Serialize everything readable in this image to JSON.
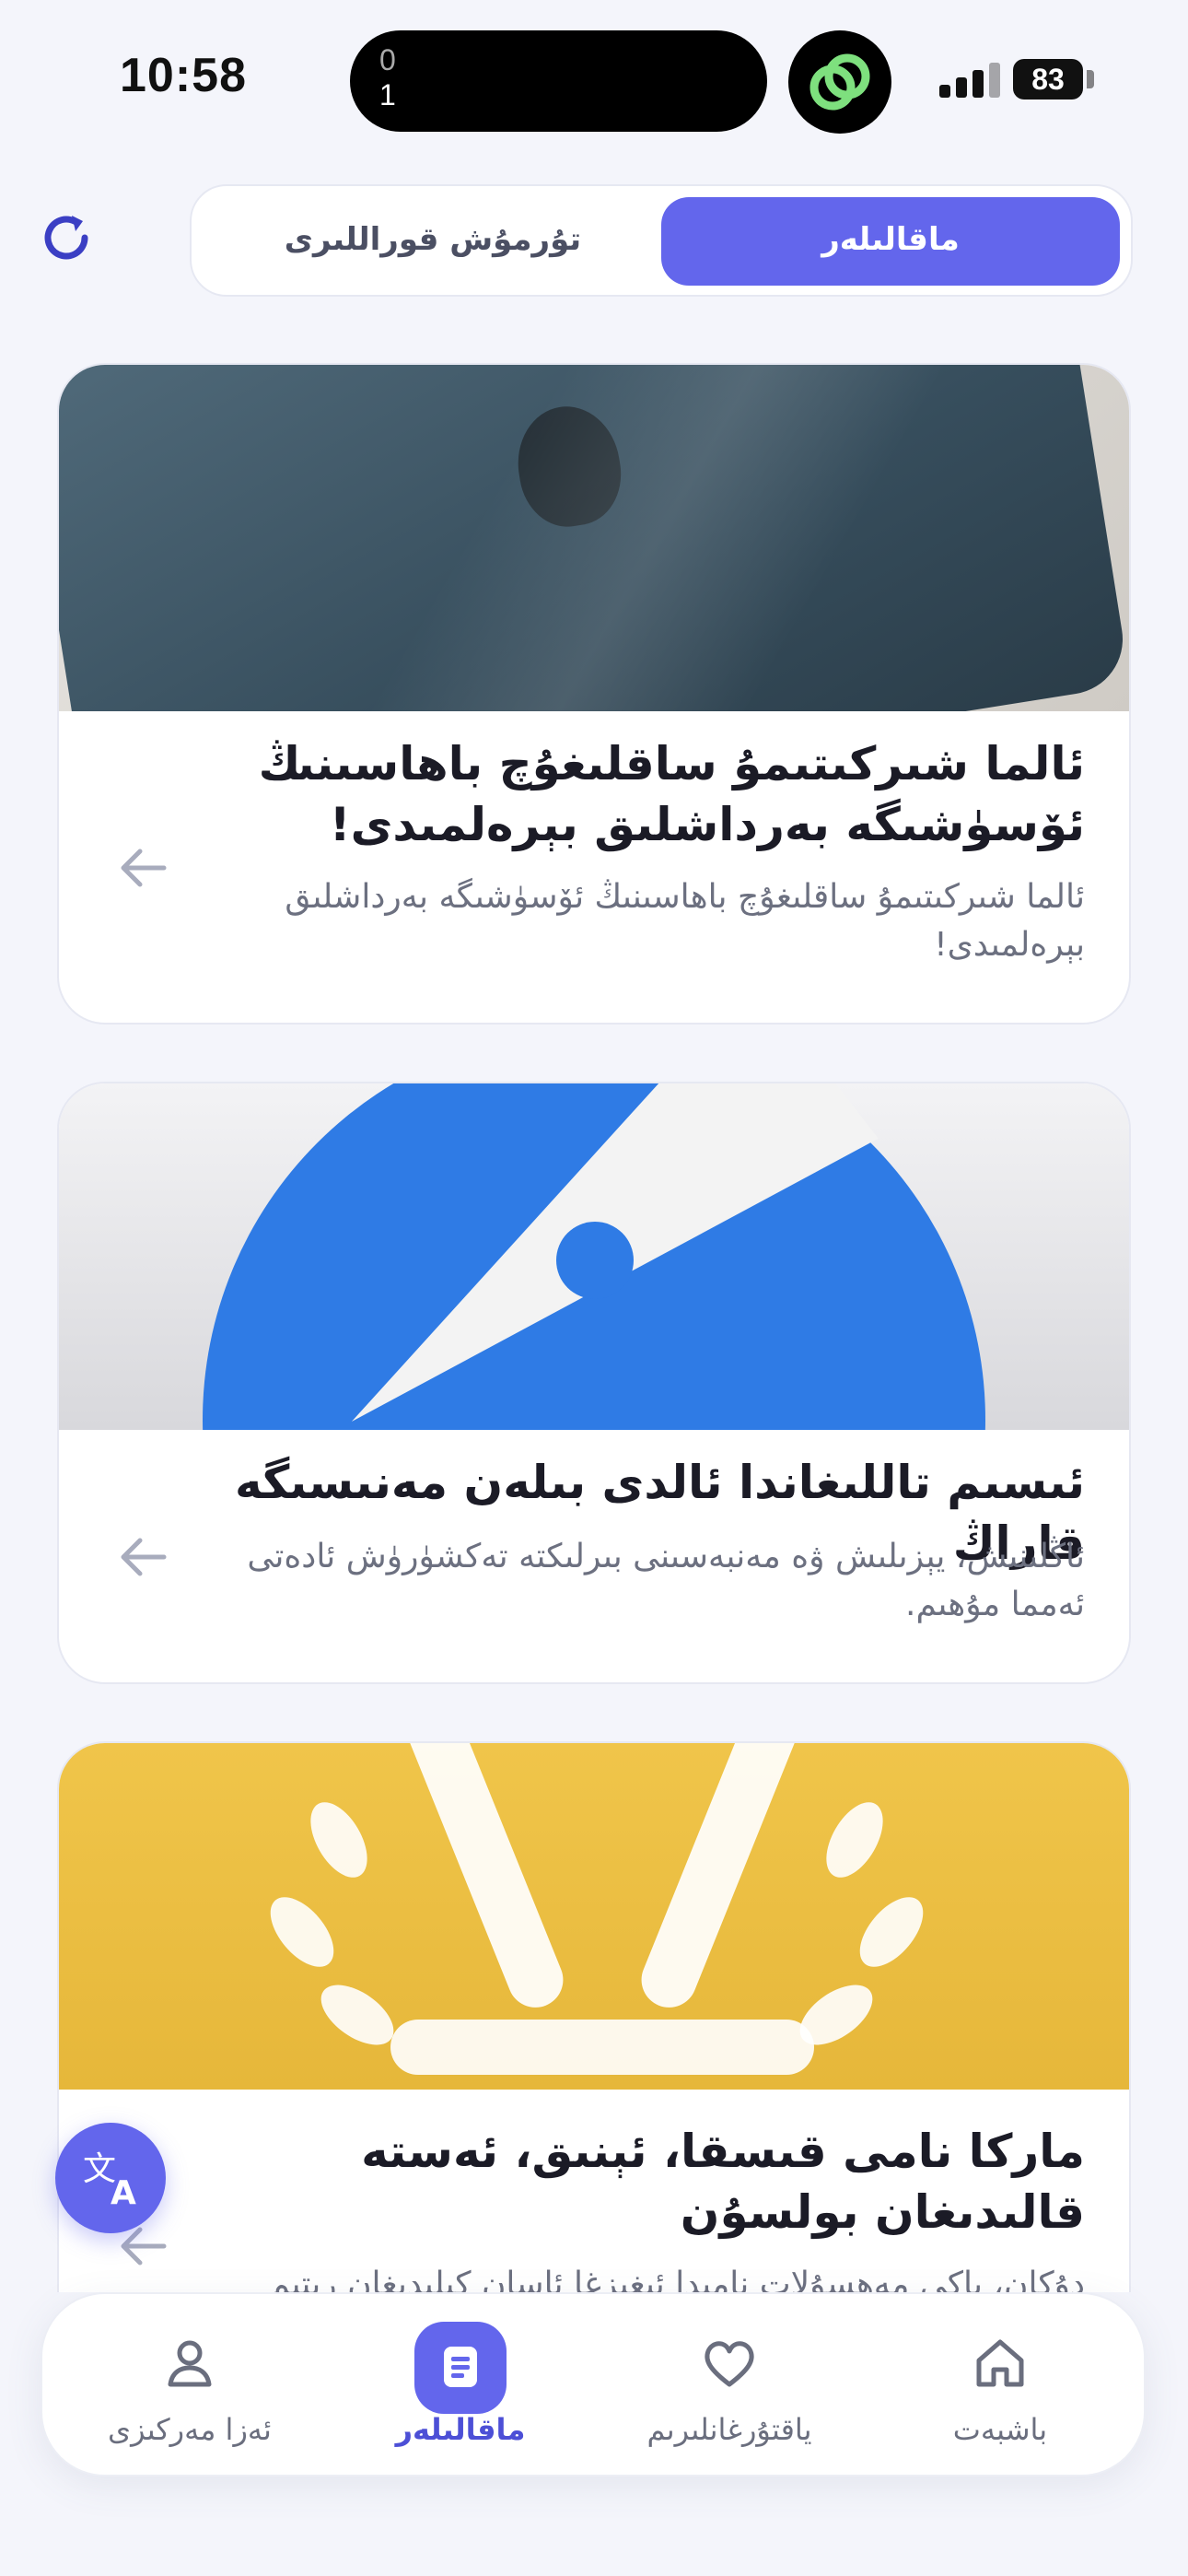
{
  "status_bar": {
    "time": "10:58",
    "island_top": "0",
    "island_bottom": "1",
    "battery": "83"
  },
  "header": {
    "tabs": [
      {
        "label": "ماقالىلەر",
        "active": true
      },
      {
        "label": "تۇرمۇش قوراللىرى",
        "active": false
      }
    ]
  },
  "articles": [
    {
      "title": "ئالما شىركىتىمۇ ساقلىغۇچ باھاسىنىڭ ئۆسۈشىگە بەرداشلىق بېرەلمىدى!",
      "summary": "ئالما شىركىتىمۇ ساقلىغۇچ باھاسىنىڭ ئۆسۈشىگە بەرداشلىق بېرەلمىدى!",
      "image": "phone"
    },
    {
      "title": "ئىسىم تاللىغاندا ئالدى بىلەن مەنىسىگە قاراڭ",
      "summary": "ئاڭلىنىش، يېزىلىش ۋە مەنبەسىنى بىرلىكتە تەكشۈرۈش ئادەتى ئەمما مۇھىم.",
      "image": "compass"
    },
    {
      "title": "ماركا نامى قىسقا، ئېنىق، ئەستە قالىدىغان بولسۇن",
      "summary": "دۇكان، ياكى مەھسۇلات نامىدا ئېغىزغا ئاسان كېلىدىغان رىتىم",
      "image": "laurel"
    }
  ],
  "bottom_nav": [
    {
      "label": "باشبەت",
      "icon": "home-icon"
    },
    {
      "label": "ياقتۇرغانلىرىم",
      "icon": "heart-icon"
    },
    {
      "label": "ماقالىلەر",
      "icon": "document-icon",
      "active": true
    },
    {
      "label": "ئەزا مەركىزى",
      "icon": "user-icon"
    }
  ],
  "colors": {
    "accent": "#6366ec",
    "background": "#f4f5fb"
  }
}
